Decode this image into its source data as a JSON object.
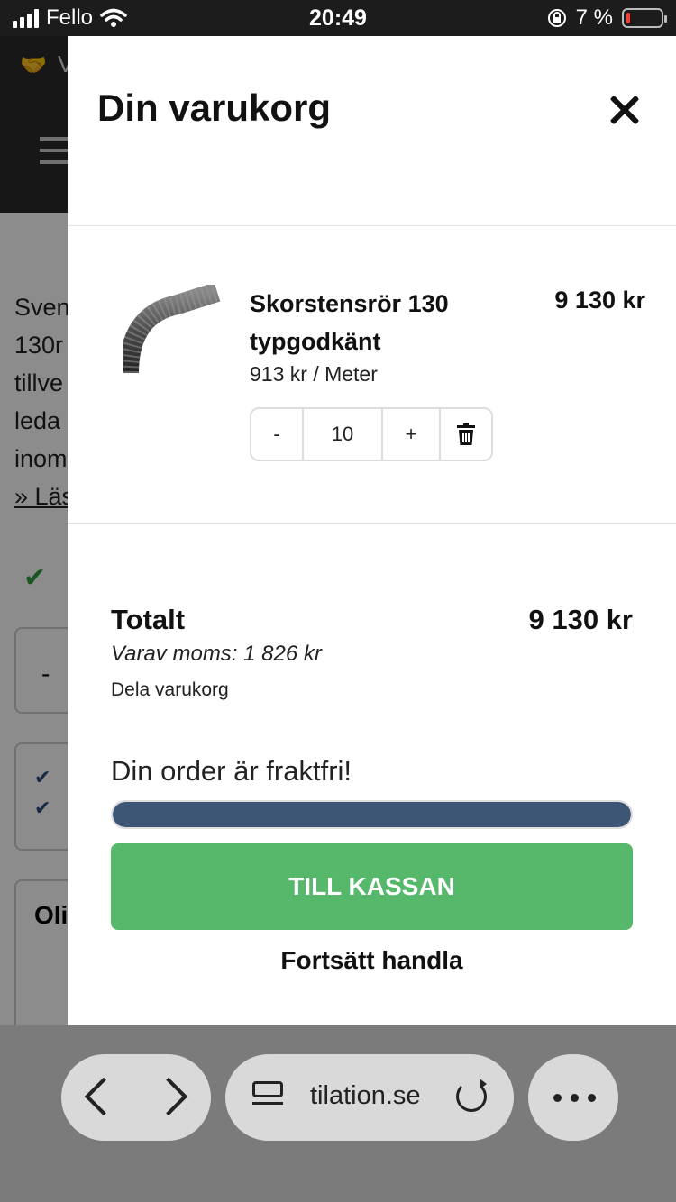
{
  "status_bar": {
    "carrier": "Fello",
    "time": "20:49",
    "battery_percent": "7 %"
  },
  "background_page": {
    "text_lines": [
      "Sven",
      "130r",
      "tillve",
      "leda",
      "inom"
    ],
    "link": "» Läs",
    "box_minus": "-",
    "title_fragment": "Oli"
  },
  "cart": {
    "title": "Din varukorg",
    "close_icon": "close-icon",
    "item": {
      "name": "Skorstensrör 130 typgodkänt",
      "price": "9 130 kr",
      "unit_price": "913 kr / Meter",
      "quantity": "10",
      "minus_label": "-",
      "plus_label": "+",
      "trash_icon": "trash-icon"
    },
    "totals": {
      "label": "Totalt",
      "value": "9 130 kr",
      "vat": "Varav moms: 1 826 kr",
      "share": "Dela varukorg"
    },
    "shipping": {
      "message": "Din order är fraktfri!",
      "progress_fraction": 1.0,
      "progress_color": "#3e5676"
    },
    "checkout_label": "TILL KASSAN",
    "checkout_color": "#55b86a",
    "continue_label": "Fortsätt handla"
  },
  "browser": {
    "url": "tilation.se",
    "icons": [
      "back-icon",
      "forward-icon",
      "reader-icon",
      "reload-icon",
      "more-icon"
    ]
  }
}
